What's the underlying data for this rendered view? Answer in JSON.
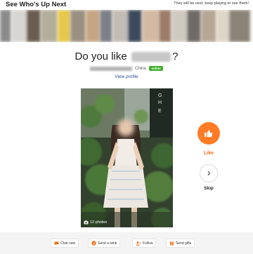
{
  "header": {
    "title": "See Who's Up Next",
    "note": "They will be next, keep playing to see them!"
  },
  "question": {
    "prefix": "Do you like",
    "suffix": "?"
  },
  "profile": {
    "location": "China",
    "status_badge": "online",
    "view_profile": "View profile",
    "photo_count": "12 photos"
  },
  "actions": {
    "like_label": "Like",
    "skip_label": "Skip"
  },
  "bottom_actions": {
    "chat": "Chat now",
    "wink": "Send a wink",
    "follow": "Follow",
    "gifts": "Send gifts"
  },
  "colors": {
    "accent": "#ff7b26",
    "link": "#2a4d9b",
    "online": "#3fae2a"
  }
}
